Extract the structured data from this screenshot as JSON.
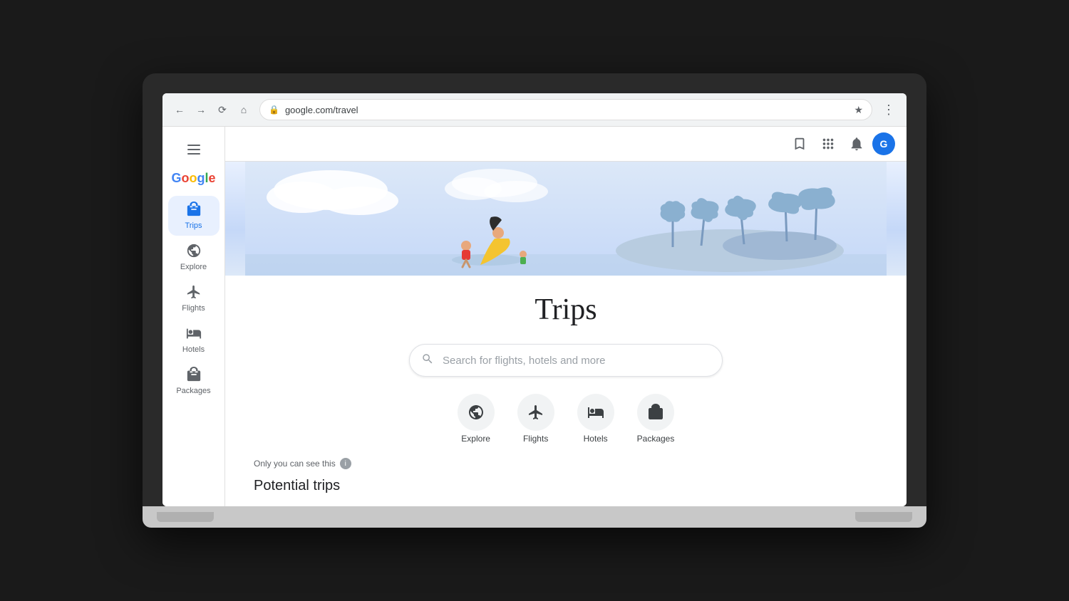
{
  "browser": {
    "url": "google.com/travel",
    "back_tooltip": "Back",
    "forward_tooltip": "Forward",
    "refresh_tooltip": "Refresh",
    "home_tooltip": "Home",
    "menu_tooltip": "Menu"
  },
  "header": {
    "hamburger_label": "Main menu",
    "google_logo": "Google",
    "bookmarks_icon": "bookmarks",
    "apps_icon": "apps",
    "notifications_icon": "notifications",
    "avatar_label": "G"
  },
  "sidebar": {
    "items": [
      {
        "id": "trips",
        "label": "Trips",
        "icon": "✈",
        "active": true
      },
      {
        "id": "explore",
        "label": "Explore",
        "icon": "◎"
      },
      {
        "id": "flights",
        "label": "Flights",
        "icon": "✈"
      },
      {
        "id": "hotels",
        "label": "Hotels",
        "icon": "🏨"
      },
      {
        "id": "packages",
        "label": "Packages",
        "icon": "🏷"
      }
    ]
  },
  "hero": {
    "title": "Trips"
  },
  "search": {
    "placeholder": "Search for flights, hotels and more"
  },
  "quick_nav": {
    "items": [
      {
        "id": "explore",
        "label": "Explore",
        "icon": "◎"
      },
      {
        "id": "flights",
        "label": "Flights",
        "icon": "✈"
      },
      {
        "id": "hotels",
        "label": "Hotels",
        "icon": "🏨"
      },
      {
        "id": "packages",
        "label": "Packages",
        "icon": "🏷"
      }
    ]
  },
  "privacy": {
    "text": "Only you can see this"
  },
  "section": {
    "potential_trips": "Potential trips"
  }
}
